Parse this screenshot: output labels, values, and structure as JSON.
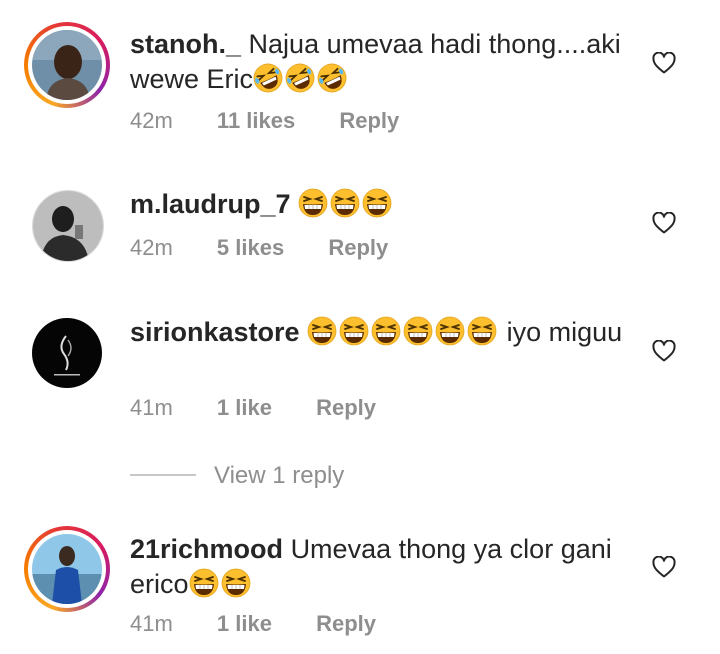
{
  "comments": [
    {
      "username": "stanoh._",
      "text": "Najua umevaa hadi thong....aki wewe Eric",
      "emoji": [
        "rofl",
        "rofl",
        "rofl"
      ],
      "time": "42m",
      "likes": "11 likes",
      "reply": "Reply",
      "has_story_ring": true
    },
    {
      "username": "m.laudrup_7",
      "text": "",
      "emoji": [
        "grin",
        "grin",
        "grin"
      ],
      "time": "42m",
      "likes": "5 likes",
      "reply": "Reply",
      "has_story_ring": false
    },
    {
      "username": "sirionkastore",
      "text_before": "",
      "emoji": [
        "grin",
        "grin",
        "grin",
        "grin",
        "grin",
        "grin"
      ],
      "text_after": "iyo miguu",
      "time": "41m",
      "likes": "1 like",
      "reply": "Reply",
      "has_story_ring": false
    },
    {
      "username": "21richmood",
      "text": "Umevaa thong ya clor gani erico",
      "emoji": [
        "grin",
        "grin"
      ],
      "time": "41m",
      "likes": "1 like",
      "reply": "Reply",
      "has_story_ring": true
    }
  ],
  "view_replies": "View 1 reply",
  "icons": {
    "like": "heart-outline-icon",
    "rofl": "rolling-on-floor-laughing-emoji",
    "grin": "grinning-squinting-face-emoji"
  },
  "colors": {
    "username": "#262626",
    "meta": "#8e8e8e",
    "emoji_yellow": "#fdbf2d",
    "ring_start": "#f9a825",
    "ring_end": "#d81b60"
  }
}
